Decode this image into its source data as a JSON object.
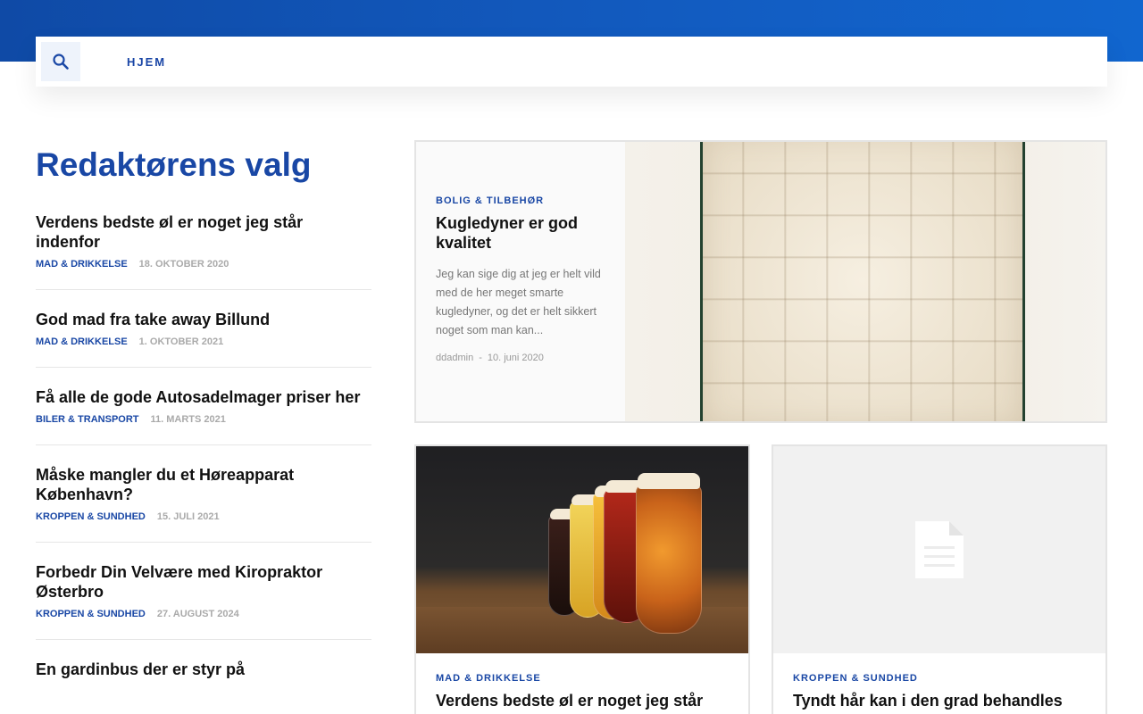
{
  "nav": {
    "home_label": "HJEM"
  },
  "editors_pick": {
    "title": "Redaktørens valg",
    "posts": [
      {
        "title": "Verdens bedste øl er noget jeg står indenfor",
        "category": "MAD & DRIKKELSE",
        "date": "18. OKTOBER 2020"
      },
      {
        "title": "God mad fra take away Billund",
        "category": "MAD & DRIKKELSE",
        "date": "1. OKTOBER 2021"
      },
      {
        "title": "Få alle de gode Autosadelmager priser her",
        "category": "BILER & TRANSPORT",
        "date": "11. MARTS 2021"
      },
      {
        "title": "Måske mangler du et Høreapparat København?",
        "category": "KROPPEN & SUNDHED",
        "date": "15. JULI 2021"
      },
      {
        "title": "Forbedr Din Velvære med Kiropraktor Østerbro",
        "category": "KROPPEN & SUNDHED",
        "date": "27. AUGUST 2024"
      },
      {
        "title": "En gardinbus der er styr på",
        "category": "",
        "date": ""
      }
    ]
  },
  "featured": {
    "category": "BOLIG & TILBEHØR",
    "title": "Kugledyner er god kvalitet",
    "excerpt": "Jeg kan sige dig at jeg er helt vild med de her meget smarte kugledyner, og det er helt sikkert noget som man kan...",
    "author": "ddadmin",
    "separator": "-",
    "date": "10. juni 2020"
  },
  "cards": [
    {
      "category": "MAD & DRIKKELSE",
      "title": "Verdens bedste øl er noget jeg står"
    },
    {
      "category": "KROPPEN & SUNDHED",
      "title": "Tyndt hår kan i den grad behandles"
    }
  ],
  "colors": {
    "brand_blue": "#1947a5",
    "top_band": "#1259bd"
  }
}
